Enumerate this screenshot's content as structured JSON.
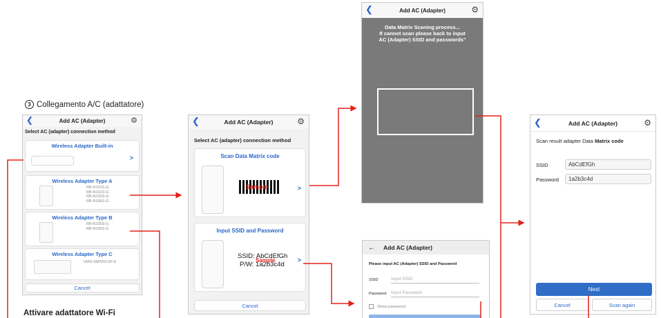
{
  "step": {
    "number": "3",
    "title": "Collegamento A/C (adattatore)"
  },
  "footer_text": "Attivare adattatore Wi-Fi",
  "screen1": {
    "title": "Add AC (Adapter)",
    "subtitle": "Select AC (adapter) connection method",
    "options": [
      {
        "title": "Wireless Adapter Built-in",
        "models": ""
      },
      {
        "title": "Wireless Adapter Type A",
        "models": "RB-N101S-G\nRB-N102S-G\nRB-N103S-G\nRB-N106S-G"
      },
      {
        "title": "Wireless Adapter Type B",
        "models": "RB-N105S-G\nRB-N106S-G"
      },
      {
        "title": "Wireless Adapter Type C",
        "models": "HWS-IWP001UP-E"
      }
    ],
    "cancel": "Cancel"
  },
  "screen2": {
    "title": "Add AC (Adapter)",
    "subtitle": "Select AC (adapter) connection method",
    "scan_title": "Scan Data Matrix code",
    "manual_title": "Input SSID and Password",
    "ssid_line": "SSID: AbCdEfGh",
    "pw_line": "P/W: 1a2b3c4d",
    "sample": "Sample",
    "cancel": "Cancel"
  },
  "screen3": {
    "title": "Add AC (Adapter)",
    "message": "Data Matrix Scaning process...\nIf cannot scan please back to input\nAC (Adapter) SSID and passwords\""
  },
  "screen4": {
    "title": "Add AC (Adapter)",
    "instruction": "Please input AC (Adapter) SSID and Password",
    "ssid_label": "SSID",
    "ssid_placeholder": "Input SSID",
    "password_label": "Password",
    "password_placeholder": "Input Password",
    "show_password": "Show password"
  },
  "screen5": {
    "title": "Add AC (Adapter)",
    "scan_result_prefix": "Scan result  adapter Data ",
    "scan_result_bold": "Matrix code",
    "ssid_label": "SSID",
    "ssid_value": "AbCdEfGh",
    "password_label": "Password",
    "password_value": "1a2b3c4d",
    "next": "Next",
    "cancel": "Cancel",
    "scan_again": "Scan again"
  },
  "colors": {
    "accent": "#2b66c9",
    "arrow": "#e32119",
    "scanner_bg": "#7a7a7a"
  }
}
